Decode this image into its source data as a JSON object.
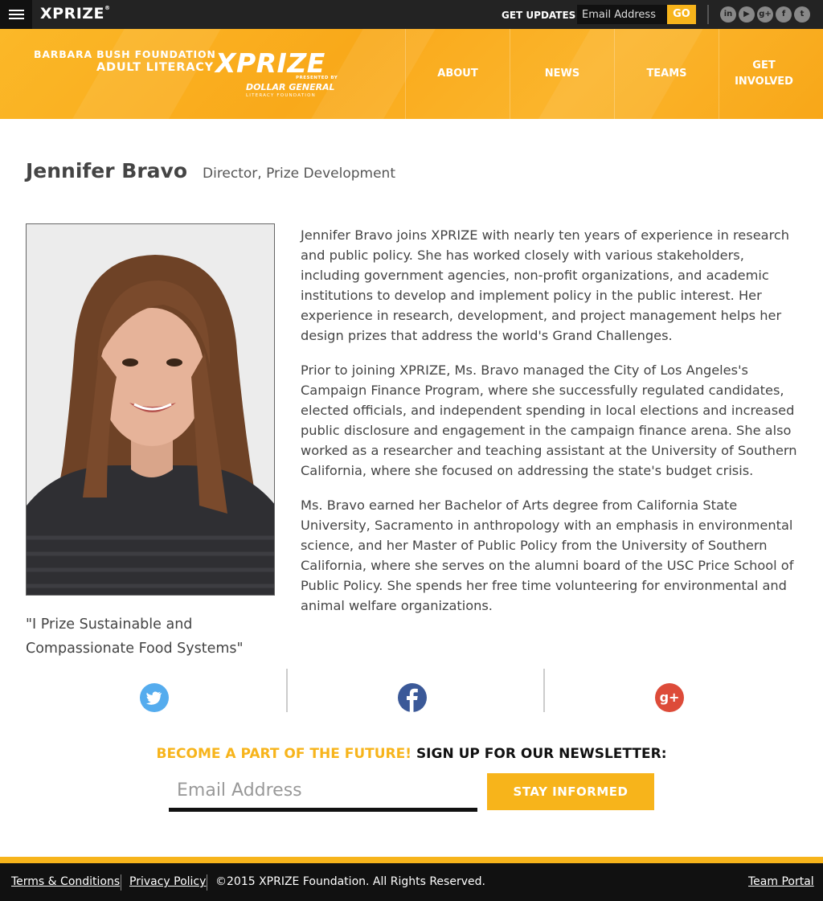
{
  "topbar": {
    "logo": "XPRIZE",
    "get_updates": "GET UPDATES",
    "email_placeholder": "Email Address",
    "go": "GO",
    "social_icons": [
      "linkedin-icon",
      "youtube-icon",
      "googleplus-icon",
      "facebook-icon",
      "twitter-icon"
    ]
  },
  "header": {
    "brand_line1": "BARBARA BUSH FOUNDATION",
    "brand_line2": "ADULT LITERACY",
    "brand_xprize": "XPRIZE",
    "presented_by": "PRESENTED BY",
    "sponsor": "DOLLAR GENERAL",
    "sponsor_sub": "LITERACY FOUNDATION",
    "nav": [
      {
        "label": "ABOUT"
      },
      {
        "label": "NEWS"
      },
      {
        "label": "TEAMS"
      },
      {
        "label": "GET INVOLVED"
      }
    ]
  },
  "profile": {
    "name": "Jennifer Bravo",
    "title": "Director, Prize Development",
    "quote": "\"I Prize Sustainable and Compassionate Food Systems\"",
    "bio": [
      "Jennifer Bravo joins XPRIZE with nearly ten years of experience in research and public policy. She has worked closely with various stakeholders, including government agencies, non-profit organizations, and academic institutions to develop and implement policy in the public interest. Her experience in research, development, and project management helps her design prizes that address the world's Grand Challenges.",
      "Prior to joining XPRIZE, Ms. Bravo managed the City of Los Angeles's Campaign Finance Program, where she successfully regulated candidates, elected officials, and independent spending in local elections and increased public disclosure and engagement in the campaign finance arena. She also worked as a researcher and teaching assistant at the University of Southern California, where she focused on addressing the state's budget crisis.",
      "Ms. Bravo earned her Bachelor of Arts degree from California State University, Sacramento in anthropology with an emphasis in environmental science, and her Master of Public Policy from the University of Southern California, where she serves on the alumni board of the USC Price School of Public Policy. She spends her free time volunteering for environmental and animal welfare organizations."
    ]
  },
  "share": {
    "icons": [
      "twitter-icon",
      "facebook-icon",
      "googleplus-icon"
    ],
    "colors": {
      "twitter": "#55acee",
      "facebook": "#3b5998",
      "googleplus": "#dd4b39"
    }
  },
  "newsletter": {
    "title_highlight": "BECOME A PART OF THE FUTURE!",
    "title_rest": "SIGN UP FOR OUR NEWSLETTER:",
    "email_placeholder": "Email Address",
    "button": "STAY INFORMED"
  },
  "footer": {
    "terms": "Terms & Conditions",
    "privacy": "Privacy Policy",
    "copyright": "©2015 XPRIZE Foundation. All Rights Reserved.",
    "team_portal": "Team Portal"
  },
  "colors": {
    "accent": "#f7b41b",
    "topbar": "#232323",
    "footer": "#111111",
    "text": "#444444"
  }
}
